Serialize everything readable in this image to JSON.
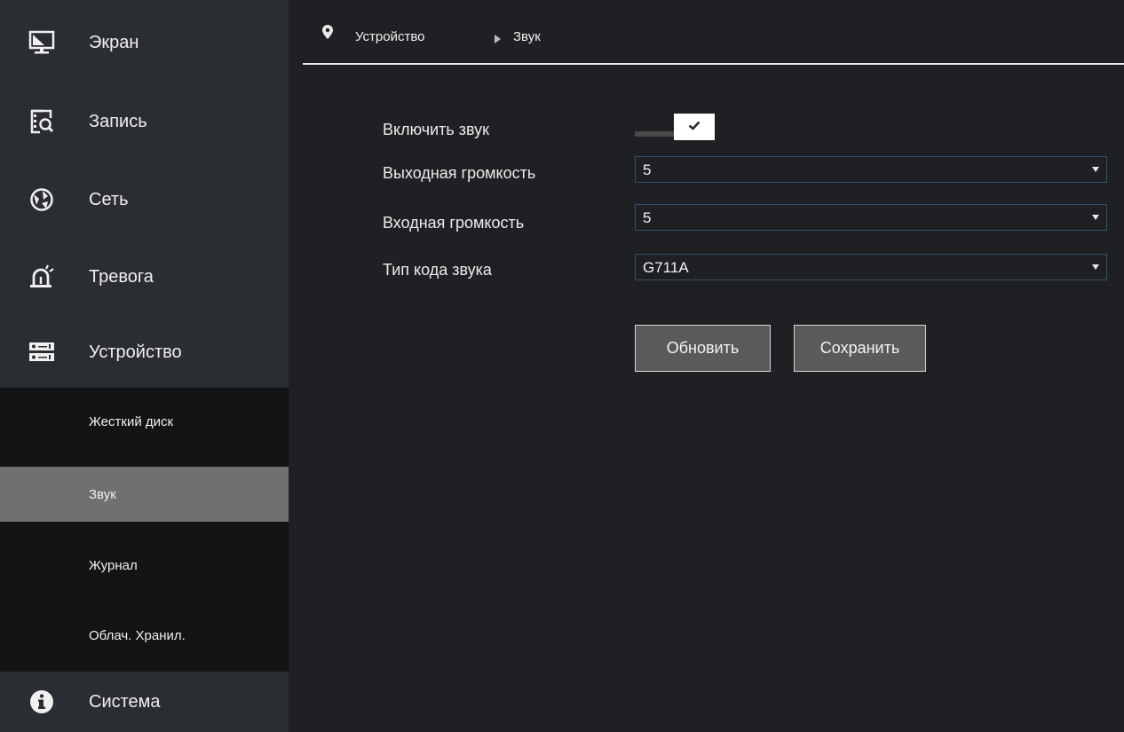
{
  "sidebar": {
    "main_items": [
      {
        "label": "Экран",
        "icon": "monitor-icon"
      },
      {
        "label": "Запись",
        "icon": "record-search-icon"
      },
      {
        "label": "Сеть",
        "icon": "network-globe-icon"
      },
      {
        "label": "Тревога",
        "icon": "alarm-siren-icon"
      },
      {
        "label": "Устройство",
        "icon": "device-storage-icon"
      },
      {
        "label": "Система",
        "icon": "info-icon"
      }
    ],
    "sub_items": [
      {
        "label": "Жесткий диск"
      },
      {
        "label": "Звук",
        "active": true
      },
      {
        "label": "Журнал"
      },
      {
        "label": "Облач. Хранил."
      }
    ]
  },
  "breadcrumb": {
    "icon": "location-pin-icon",
    "parent": "Устройство",
    "separator_icon": "triangle-right-icon",
    "current": "Звук"
  },
  "form": {
    "enable_sound": {
      "label": "Включить звук",
      "checked": true
    },
    "output_volume": {
      "label": "Выходная громкость",
      "value": "5"
    },
    "input_volume": {
      "label": "Входная громкость",
      "value": "5"
    },
    "codec_type": {
      "label": "Тип кода звука",
      "value": "G711A"
    }
  },
  "buttons": {
    "refresh": "Обновить",
    "save": "Сохранить"
  },
  "colors": {
    "sidebar_bg": "#2a2d31",
    "submenu_bg": "#131416",
    "active_sub_bg": "#707070",
    "content_bg": "#1f2023",
    "select_border": "#34506a",
    "button_bg": "#5a5a5a"
  }
}
